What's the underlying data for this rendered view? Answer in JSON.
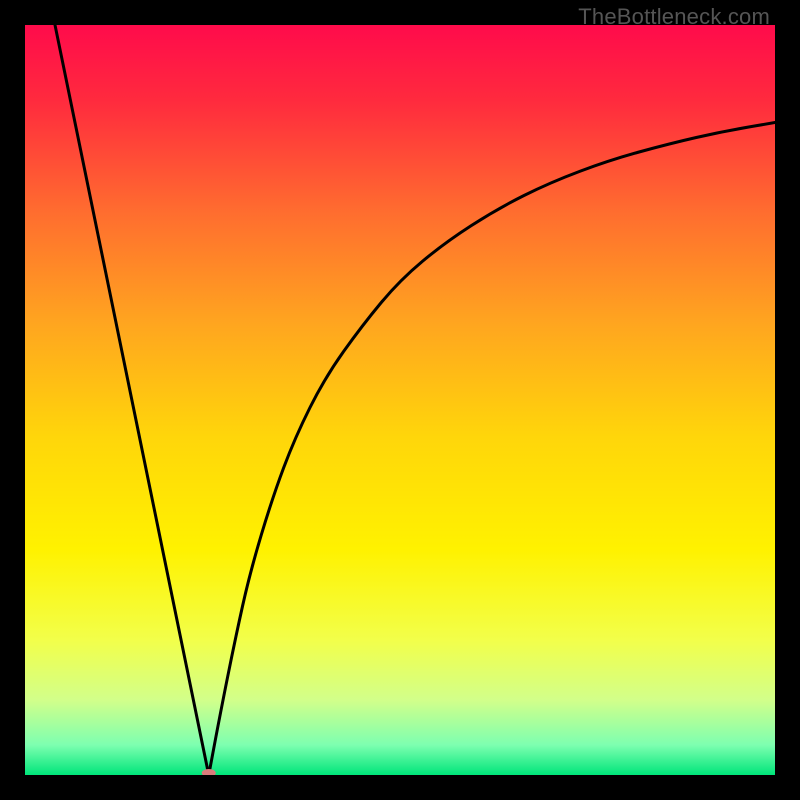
{
  "watermark": "TheBottleneck.com",
  "chart_data": {
    "type": "line",
    "title": "",
    "xlabel": "",
    "ylabel": "",
    "xlim": [
      0,
      100
    ],
    "ylim": [
      0,
      100
    ],
    "grid": false,
    "legend": false,
    "background_gradient": {
      "stops": [
        {
          "offset": 0.0,
          "color": "#ff0b4b"
        },
        {
          "offset": 0.1,
          "color": "#ff2a3e"
        },
        {
          "offset": 0.25,
          "color": "#ff6d2f"
        },
        {
          "offset": 0.4,
          "color": "#ffa61f"
        },
        {
          "offset": 0.55,
          "color": "#ffd60a"
        },
        {
          "offset": 0.7,
          "color": "#fff200"
        },
        {
          "offset": 0.82,
          "color": "#f2ff4a"
        },
        {
          "offset": 0.9,
          "color": "#d2ff8a"
        },
        {
          "offset": 0.96,
          "color": "#7dffb0"
        },
        {
          "offset": 1.0,
          "color": "#00e57a"
        }
      ]
    },
    "series": [
      {
        "name": "left-branch",
        "stroke": "#000000",
        "x": [
          4,
          24.5
        ],
        "y": [
          100,
          0
        ]
      },
      {
        "name": "right-branch",
        "stroke": "#000000",
        "x": [
          24.5,
          26,
          28,
          30,
          33,
          36,
          40,
          45,
          50,
          56,
          63,
          70,
          78,
          86,
          93,
          100
        ],
        "y": [
          0,
          8,
          18,
          27,
          37,
          45,
          53,
          60,
          66,
          71,
          75.5,
          79,
          82,
          84.2,
          85.8,
          87
        ]
      }
    ],
    "marker": {
      "name": "min-marker",
      "x": 24.5,
      "y": 0,
      "rx": 7,
      "ry": 4,
      "color": "#d97c7c"
    }
  }
}
